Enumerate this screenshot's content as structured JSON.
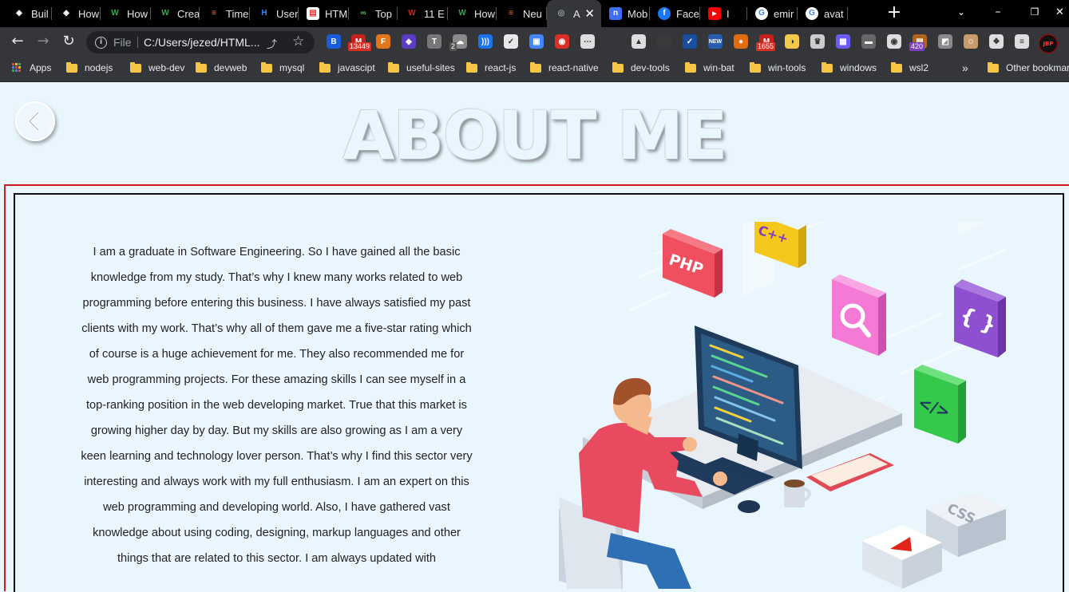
{
  "browser": {
    "tabs": [
      {
        "title": "Buil",
        "favicon": "webflow-icon",
        "color": "#ffffff"
      },
      {
        "title": "How",
        "favicon": "webflow-icon",
        "color": "#ffffff"
      },
      {
        "title": "How",
        "favicon": "w-icon",
        "color": "#3aa757"
      },
      {
        "title": "Crea",
        "favicon": "w-icon",
        "color": "#3aa757"
      },
      {
        "title": "Time",
        "favicon": "t-stack-icon",
        "color": "#ff6e40"
      },
      {
        "title": "User",
        "favicon": "h-icon",
        "color": "#2b8cff"
      },
      {
        "title": "HTM",
        "favicon": "page-icon",
        "color": "#ffffff"
      },
      {
        "title": "Top",
        "favicon": "infinity-icon",
        "color": "#6abf69"
      },
      {
        "title": "11 E",
        "favicon": "w-red-icon",
        "color": "#c62828"
      },
      {
        "title": "How",
        "favicon": "w-icon",
        "color": "#3aa757"
      },
      {
        "title": "Neu",
        "favicon": "t-stack-icon",
        "color": "#ff6e40"
      },
      {
        "title": "A",
        "favicon": "globe-icon",
        "color": "#9aa0a6",
        "active": true
      },
      {
        "title": "Mob",
        "favicon": "n-icon",
        "color": "#3d6df2"
      },
      {
        "title": "Face",
        "favicon": "facebook-icon",
        "color": "#1877f2"
      },
      {
        "title": "I",
        "favicon": "youtube-icon",
        "color": "#ff0000"
      },
      {
        "title": "emir",
        "favicon": "google-icon",
        "color": "#ffffff"
      },
      {
        "title": "avat",
        "favicon": "google-icon",
        "color": "#ffffff"
      }
    ],
    "new_tab_label": "+",
    "window_controls": {
      "minimize": "–",
      "restore": "❐",
      "close": "✕",
      "tab_search": "⌄"
    },
    "address": {
      "scheme": "File",
      "url": "C:/Users/jezed/HTML..."
    },
    "extensions": [
      {
        "icon": "bitwarden-icon",
        "color": "#175ddc",
        "text": "B"
      },
      {
        "icon": "gmail-icon",
        "color": "#c5221f",
        "text": "M",
        "badge": "13449"
      },
      {
        "icon": "metamask-icon",
        "color": "#e2761b",
        "text": "F"
      },
      {
        "icon": "cube-icon",
        "color": "#5b3cc4",
        "text": "◆"
      },
      {
        "icon": "text-icon",
        "color": "#777777",
        "text": "T"
      },
      {
        "icon": "cloud-icon",
        "color": "#8a8a8a",
        "text": "☁",
        "badge": "2",
        "badge_style": "dark"
      },
      {
        "icon": "wave-icon",
        "color": "#1a73e8",
        "text": ")))"
      },
      {
        "icon": "chart-ext-icon",
        "color": "#e8e8e8",
        "text": "✓"
      },
      {
        "icon": "clipboard-icon",
        "color": "#4285f4",
        "text": "▣"
      },
      {
        "icon": "camera-icon",
        "color": "#d93025",
        "text": "◉"
      },
      {
        "icon": "more-ext-icon",
        "color": "#dddddd",
        "text": "⋯"
      },
      {
        "icon": "ghost-icon",
        "color": "#dddddd",
        "text": "▲"
      },
      {
        "icon": "hidden-ext-icon",
        "color": "#3a3a3a",
        "text": ""
      },
      {
        "icon": "check-circle-icon",
        "color": "#1a4fa0",
        "text": "✓"
      },
      {
        "icon": "new-icon",
        "color": "#2a5db0",
        "text": "NEW"
      },
      {
        "icon": "record-icon",
        "color": "#e06d10",
        "text": "●"
      },
      {
        "icon": "mail-icon",
        "color": "#c5221f",
        "text": "M",
        "badge": "1655"
      },
      {
        "icon": "python-icon",
        "color": "#f2c94c",
        "text": "◑"
      },
      {
        "icon": "crown-icon",
        "color": "#cccccc",
        "text": "♛"
      },
      {
        "icon": "grid-ext-icon",
        "color": "#6b5cf6",
        "text": "▦"
      },
      {
        "icon": "hat-icon",
        "color": "#666666",
        "text": "▬"
      },
      {
        "icon": "bulb-icon",
        "color": "#dddddd",
        "text": "◉"
      },
      {
        "icon": "calendar-icon",
        "color": "#b0641c",
        "text": "▤",
        "badge": "420",
        "badge_style": "purple"
      },
      {
        "icon": "square-ext-icon",
        "color": "#8a8a8a",
        "text": "◩"
      },
      {
        "icon": "face-icon",
        "color": "#c89b6a",
        "text": "☺"
      },
      {
        "icon": "puzzle-icon",
        "color": "#dddddd",
        "text": "❖"
      },
      {
        "icon": "reading-list-icon",
        "color": "#dddddd",
        "text": "≡"
      }
    ],
    "profile_text": "JBP",
    "bookmarks": {
      "apps": "Apps",
      "folders": [
        "nodejs",
        "web-dev",
        "devweb",
        "mysql",
        "javascipt",
        "useful-sites",
        "react-js",
        "react-native",
        "dev-tools",
        "win-bat",
        "win-tools",
        "windows",
        "wsl2"
      ],
      "overflow": "»",
      "other": "Other bookmarks"
    }
  },
  "page": {
    "heading": "ABOUT ME",
    "about_text": "I am a graduate in Software Engineering. So I have gained all the basic knowledge from my study. That’s why I knew many works related to web programming before entering this business. I have always satisfied my past clients with my work. That’s why all of them gave me a five-star rating which of course is a huge achievement for me. They also recommended me for web programming projects. For these amazing skills I can see myself in a top-ranking position in the web developing market. True that this market is growing higher day by day. But my skills are also growing as I am a very keen learning and technology lover person. That’s why I find this sector very interesting and always work with my full enthusiasm. I am an expert on this web programming and developing world. Also, I have gathered vast knowledge about using coding, designing, markup languages and other things that are related to this sector. I am always updated with",
    "illustration": {
      "tiles": [
        "PHP",
        "C++",
        "{ }",
        "</>",
        "CSS"
      ],
      "colors": {
        "php": "#ef4f5e",
        "cpp": "#f6c81d",
        "search": "#f47ad6",
        "braces": "#8e4fd0",
        "code": "#34c94a",
        "css": "#eef2f6"
      }
    },
    "colors": {
      "background": "#eaf6fe",
      "red_frame": "#d31b1b",
      "black_frame": "#111111"
    }
  }
}
